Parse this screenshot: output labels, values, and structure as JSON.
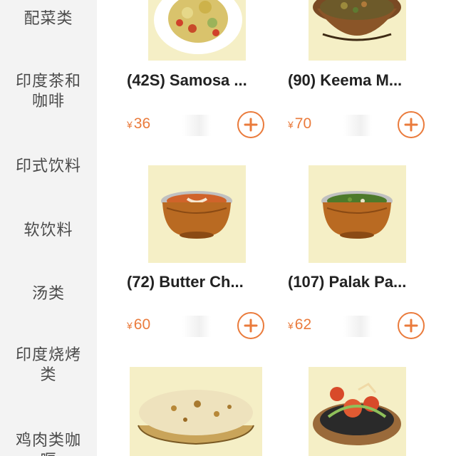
{
  "sidebar": {
    "categories": [
      {
        "label": "配菜类"
      },
      {
        "label": "印度茶和\n咖啡"
      },
      {
        "label": "印式饮料"
      },
      {
        "label": "软饮料"
      },
      {
        "label": "汤类"
      },
      {
        "label": "印度烧烤\n类"
      },
      {
        "label": "鸡肉类咖\n喱"
      }
    ]
  },
  "dishes": [
    {
      "name": "(42S) Samosa ...",
      "currency": "¥",
      "price": "36",
      "add_icon": "plus-circle-icon"
    },
    {
      "name": "(90) Keema M...",
      "currency": "¥",
      "price": "70",
      "add_icon": "plus-circle-icon"
    },
    {
      "name": "(72) Butter Ch...",
      "currency": "¥",
      "price": "60",
      "add_icon": "plus-circle-icon"
    },
    {
      "name": "(107) Palak Pa...",
      "currency": "¥",
      "price": "62",
      "add_icon": "plus-circle-icon"
    }
  ],
  "colors": {
    "accent": "#ea7b3c",
    "sidebar_bg": "#f3f3f3",
    "image_bg": "#f5efc6",
    "category_text": "#4a4a4a",
    "dish_text": "#222222"
  }
}
